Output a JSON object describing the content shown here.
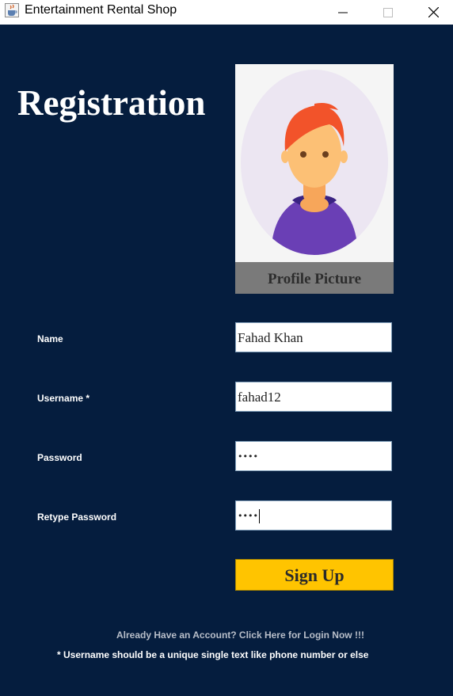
{
  "window": {
    "title": "Entertainment Rental Shop",
    "icon": "java-cup-icon"
  },
  "form": {
    "heading": "Registration",
    "profile_label": "Profile Picture",
    "fields": [
      {
        "label": "Name",
        "value": "Fahad Khan"
      },
      {
        "label": "Username *",
        "value": "fahad12"
      },
      {
        "label": "Password",
        "value": "••••"
      },
      {
        "label": "Retype Password",
        "value": "••••"
      }
    ],
    "signup_label": "Sign Up",
    "login_link": "Already Have an Account? Click Here for Login Now !!!",
    "note": "* Username should be a unique single text like phone number or else"
  },
  "colors": {
    "background": "#051d3e",
    "button": "#ffc400",
    "profile_label_bg": "#7a7a7a"
  }
}
